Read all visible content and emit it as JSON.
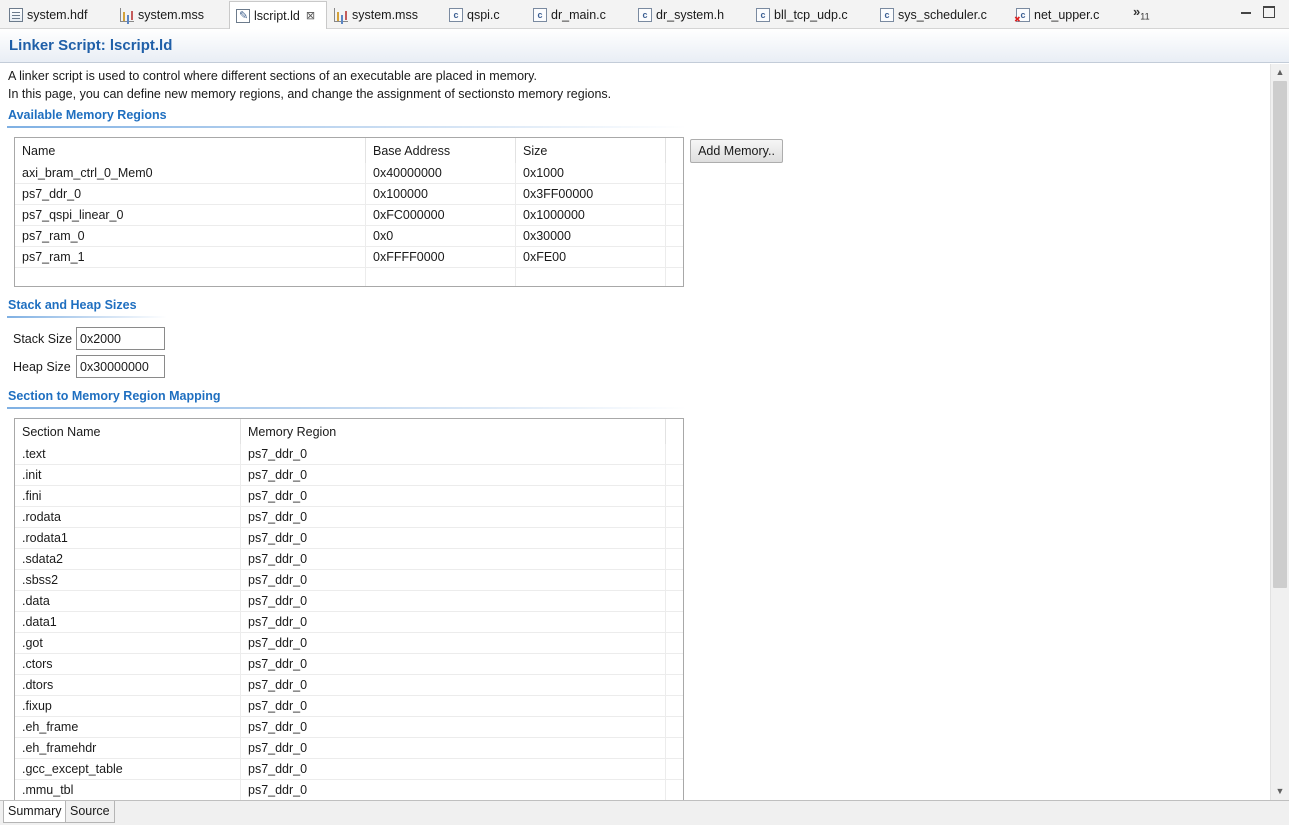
{
  "tabs": [
    {
      "label": "system.hdf",
      "icon": "hdf-document-icon"
    },
    {
      "label": "system.mss",
      "icon": "mss-bar-chart-icon"
    },
    {
      "label": "lscript.ld",
      "icon": "linker-script-icon",
      "active": true
    },
    {
      "label": "system.mss",
      "icon": "mss-bar-chart-icon"
    },
    {
      "label": "qspi.c",
      "icon": "c-file-icon"
    },
    {
      "label": "dr_main.c",
      "icon": "c-file-icon"
    },
    {
      "label": "dr_system.h",
      "icon": "c-file-icon"
    },
    {
      "label": "bll_tcp_udp.c",
      "icon": "c-file-icon"
    },
    {
      "label": "sys_scheduler.c",
      "icon": "c-file-icon"
    },
    {
      "label": "net_upper.c",
      "icon": "c-file-error-icon"
    }
  ],
  "tab_overflow": {
    "glyph": "»",
    "count": "11"
  },
  "header": {
    "title": "Linker Script: lscript.ld"
  },
  "description": {
    "line1": "A linker script is used to control where different sections of an executable are placed in memory.",
    "line2": "In this page, you can define new memory regions, and change the assignment of sectionsto memory regions."
  },
  "memory_regions": {
    "title": "Available Memory Regions",
    "columns": [
      "Name",
      "Base Address",
      "Size"
    ],
    "rows": [
      [
        "axi_bram_ctrl_0_Mem0",
        "0x40000000",
        "0x1000"
      ],
      [
        "ps7_ddr_0",
        "0x100000",
        "0x3FF00000"
      ],
      [
        "ps7_qspi_linear_0",
        "0xFC000000",
        "0x1000000"
      ],
      [
        "ps7_ram_0",
        "0x0",
        "0x30000"
      ],
      [
        "ps7_ram_1",
        "0xFFFF0000",
        "0xFE00"
      ]
    ],
    "add_button": "Add Memory.."
  },
  "stack_heap": {
    "title": "Stack and Heap Sizes",
    "stack_label": "Stack Size",
    "stack_value": "0x2000",
    "heap_label": "Heap Size",
    "heap_value": "0x30000000"
  },
  "section_mapping": {
    "title": "Section to Memory Region Mapping",
    "columns": [
      "Section Name",
      "Memory Region"
    ],
    "rows": [
      [
        ".text",
        "ps7_ddr_0"
      ],
      [
        ".init",
        "ps7_ddr_0"
      ],
      [
        ".fini",
        "ps7_ddr_0"
      ],
      [
        ".rodata",
        "ps7_ddr_0"
      ],
      [
        ".rodata1",
        "ps7_ddr_0"
      ],
      [
        ".sdata2",
        "ps7_ddr_0"
      ],
      [
        ".sbss2",
        "ps7_ddr_0"
      ],
      [
        ".data",
        "ps7_ddr_0"
      ],
      [
        ".data1",
        "ps7_ddr_0"
      ],
      [
        ".got",
        "ps7_ddr_0"
      ],
      [
        ".ctors",
        "ps7_ddr_0"
      ],
      [
        ".dtors",
        "ps7_ddr_0"
      ],
      [
        ".fixup",
        "ps7_ddr_0"
      ],
      [
        ".eh_frame",
        "ps7_ddr_0"
      ],
      [
        ".eh_framehdr",
        "ps7_ddr_0"
      ],
      [
        ".gcc_except_table",
        "ps7_ddr_0"
      ],
      [
        ".mmu_tbl",
        "ps7_ddr_0"
      ]
    ]
  },
  "bottom_tabs": [
    {
      "label": "Summary",
      "active": true
    },
    {
      "label": "Source",
      "active": false
    }
  ]
}
